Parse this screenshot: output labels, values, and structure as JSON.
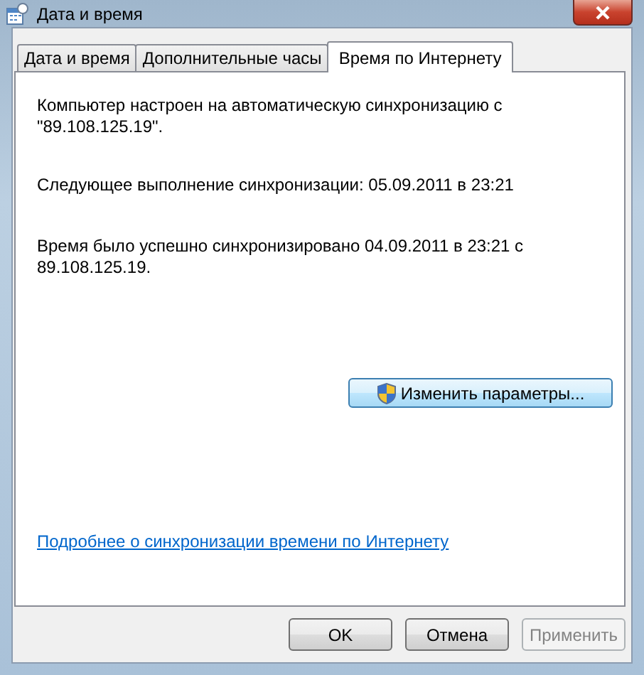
{
  "window": {
    "title": "Дата и время"
  },
  "tabs": [
    {
      "label": "Дата и время",
      "selected": false
    },
    {
      "label": "Дополнительные часы",
      "selected": false
    },
    {
      "label": "Время по Интернету",
      "selected": true
    }
  ],
  "status_lines": [
    "Компьютер настроен на автоматическую синхронизацию с \"89.108.125.19\".",
    "Следующее выполнение синхронизации: 05.09.2011 в 23:21",
    "Время было успешно синхронизировано 04.09.2011 в 23:21 с 89.108.125.19."
  ],
  "change_settings_button": {
    "label": "Изменить параметры..."
  },
  "help_link": "Подробнее о синхронизации времени по Интернету",
  "buttons": [
    {
      "label": "OK",
      "disabled": false
    },
    {
      "label": "Отмена",
      "disabled": false
    },
    {
      "label": "Применить",
      "disabled": true
    }
  ]
}
